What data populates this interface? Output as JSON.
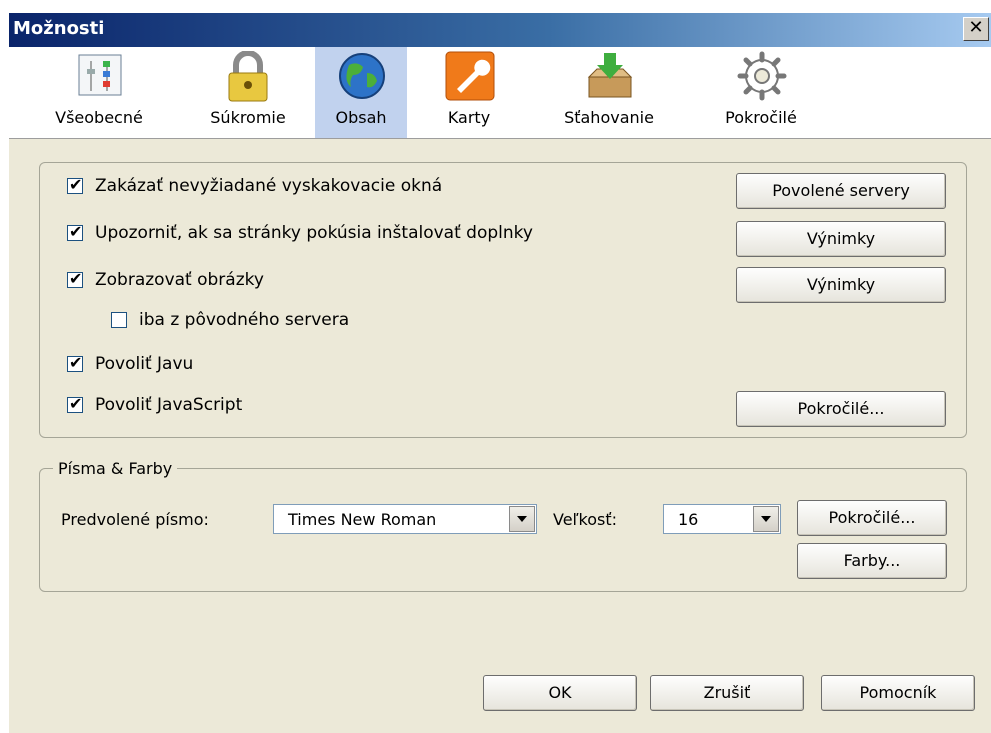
{
  "window": {
    "title": "Možnosti",
    "close_glyph": "✕"
  },
  "tabs": [
    {
      "label": "Všeobecné",
      "icon": "general-settings-icon"
    },
    {
      "label": "Súkromie",
      "icon": "padlock-icon"
    },
    {
      "label": "Obsah",
      "icon": "globe-icon",
      "selected": true
    },
    {
      "label": "Karty",
      "icon": "wrench-icon"
    },
    {
      "label": "Sťahovanie",
      "icon": "download-box-icon"
    },
    {
      "label": "Pokročilé",
      "icon": "gear-icon"
    }
  ],
  "content": {
    "block_popups": {
      "label": "Zakázať nevyžiadané vyskakovacie okná",
      "checked": true
    },
    "warn_addons": {
      "label": "Upozorniť, ak sa stránky pokúsia inštalovať doplnky",
      "checked": true
    },
    "load_images": {
      "label": "Zobrazovať obrázky",
      "checked": true
    },
    "only_origin": {
      "label": "iba z pôvodného servera",
      "checked": false
    },
    "enable_java": {
      "label": "Povoliť Javu",
      "checked": true
    },
    "enable_js": {
      "label": "Povoliť JavaScript",
      "checked": true
    },
    "btn_allowed_sites": "Povolené servery",
    "btn_exceptions_addons": "Výnimky",
    "btn_exceptions_images": "Výnimky",
    "btn_advanced_js": "Pokročilé..."
  },
  "fonts": {
    "legend": "Písma & Farby",
    "default_font_label": "Predvolené písmo:",
    "default_font_value": "Times New Roman",
    "size_label": "Veľkosť:",
    "size_value": "16",
    "btn_advanced": "Pokročilé...",
    "btn_colors": "Farby..."
  },
  "footer": {
    "ok": "OK",
    "cancel": "Zrušiť",
    "help": "Pomocník"
  },
  "colors": {
    "selected_tab": "#c1d2ee",
    "dialog_bg": "#ece9d8",
    "titlebar": "#0a246a"
  }
}
